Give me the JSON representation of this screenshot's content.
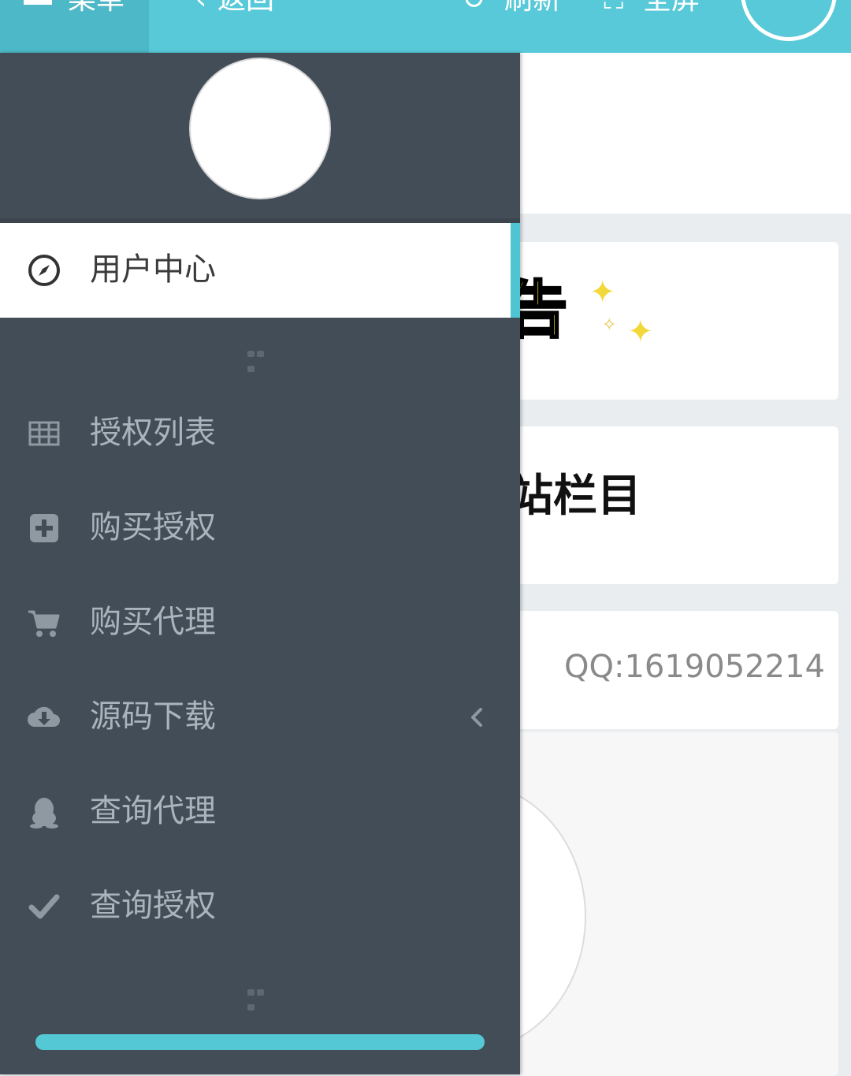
{
  "topbar": {
    "menu_label": "菜单",
    "back_label": "返回",
    "refresh_label": "刷新",
    "fullscreen_label": "全屏"
  },
  "drawer": {
    "active_item": {
      "label": "用户中心",
      "icon": "compass-icon"
    },
    "items": [
      {
        "label": "授权列表",
        "icon": "table-icon"
      },
      {
        "label": "购买授权",
        "icon": "plus-square-icon"
      },
      {
        "label": "购买代理",
        "icon": "cart-icon"
      },
      {
        "label": "源码下载",
        "icon": "cloud-download-icon",
        "has_submenu": true
      },
      {
        "label": "查询代理",
        "icon": "qq-penguin-icon"
      },
      {
        "label": "查询授权",
        "icon": "check-icon"
      }
    ]
  },
  "content": {
    "announcement_banner_text": "告",
    "section_banner_text": "站栏目",
    "contact_text": "QQ:1619052214"
  },
  "colors": {
    "accent": "#57c9d8",
    "drawer_bg": "#434d57",
    "nav_text": "#aab4bc"
  }
}
